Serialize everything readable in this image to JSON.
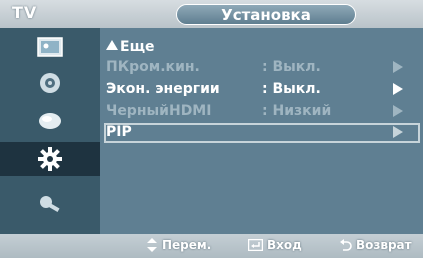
{
  "header": {
    "tv_label": "TV",
    "title": "Установка"
  },
  "sidebar": {
    "icons": [
      "picture-icon",
      "sound-icon",
      "channel-icon",
      "setup-icon",
      "input-icon"
    ],
    "active_index": 3
  },
  "menu": {
    "more_label": "Еще",
    "rows": [
      {
        "label": "ПКром.кин.",
        "value": ": Выкл."
      },
      {
        "label": "Экон. энергии",
        "value": ": Выкл."
      },
      {
        "label": "ЧерныйHDMI",
        "value": ": Низкий"
      },
      {
        "label": "PIP",
        "value": ""
      }
    ]
  },
  "footer": {
    "move": "Перем.",
    "enter": "Вход",
    "return": "Возврат"
  },
  "colors": {
    "panel": "#5f7f92",
    "sidebar": "#3a5a6a",
    "active": "#1e3340"
  }
}
